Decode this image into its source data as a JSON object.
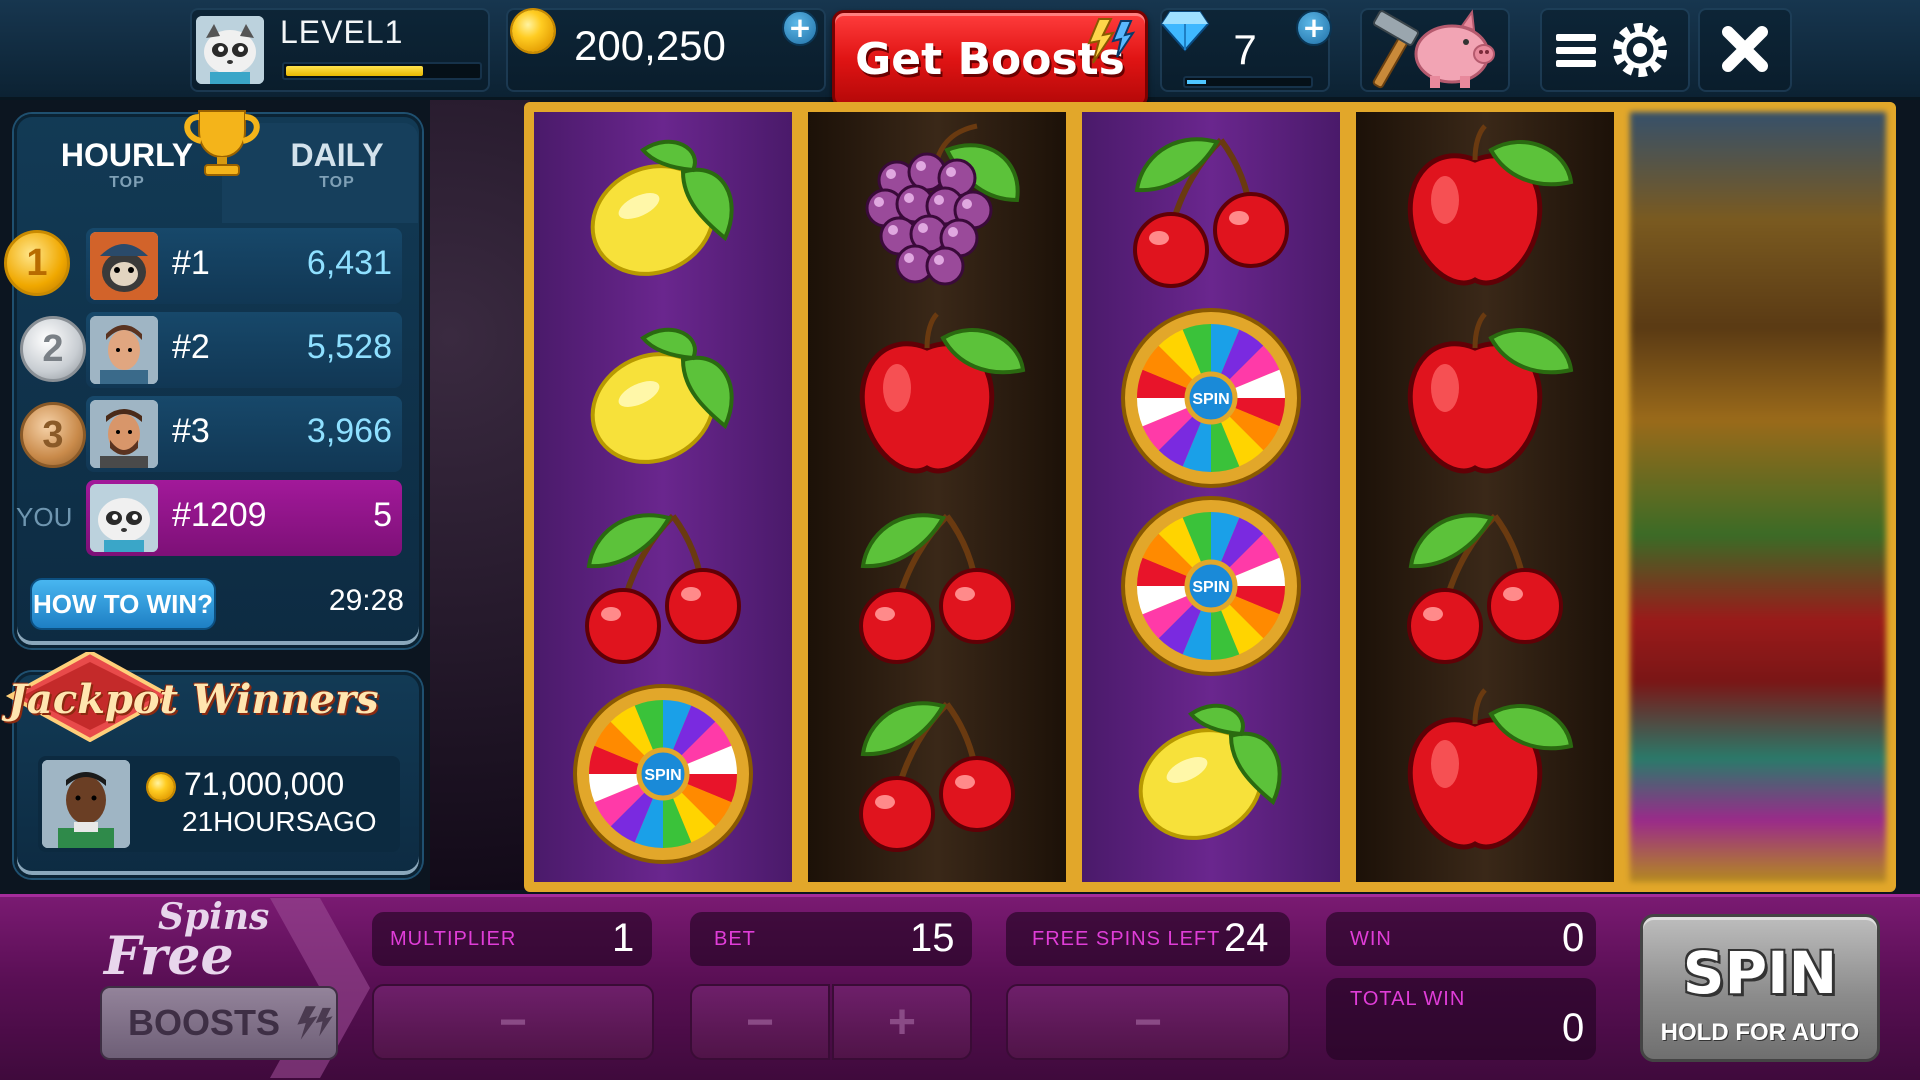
{
  "header": {
    "level_label": "LEVEL1",
    "level_progress": 0.7,
    "coins": "200,250",
    "get_boosts_label": "Get Boosts",
    "gems": "7",
    "gem_progress": 0.15
  },
  "leaderboard": {
    "tabs": [
      {
        "main": "HOURLY",
        "sub": "TOP"
      },
      {
        "main": "DAILY",
        "sub": "TOP"
      }
    ],
    "rows": [
      {
        "medal": "1",
        "rank": "#1",
        "score": "6,431"
      },
      {
        "medal": "2",
        "rank": "#2",
        "score": "5,528"
      },
      {
        "medal": "3",
        "rank": "#3",
        "score": "3,966"
      }
    ],
    "you_label": "YOU",
    "you_rank": "#1209",
    "you_score": "5",
    "how_to_win": "HOW TO WIN?",
    "timer": "29:28"
  },
  "jackpot": {
    "title": "Jackpot Winners",
    "amount": "71,000,000",
    "time_ago": "21HOURSAGO"
  },
  "reels": [
    [
      "lemon",
      "lemon",
      "cherry",
      "wheel"
    ],
    [
      "grapes",
      "apple",
      "cherry",
      "cherry"
    ],
    [
      "cherry",
      "wheel",
      "wheel",
      "lemon"
    ],
    [
      "apple",
      "apple",
      "cherry",
      "apple"
    ],
    [
      "spinning",
      "spinning",
      "spinning",
      "spinning"
    ]
  ],
  "wheel_label": "SPIN",
  "bottom": {
    "free_spins_top": "Spins",
    "free_spins_bottom": "Free",
    "boosts_label": "BOOSTS",
    "multiplier_label": "MULTIPLIER",
    "multiplier_value": "1",
    "bet_label": "BET",
    "bet_value": "15",
    "free_spins_left_label": "FREE SPINS LEFT",
    "free_spins_left_value": "24",
    "win_label": "WIN",
    "win_value": "0",
    "total_win_label": "TOTAL WIN",
    "total_win_value": "0",
    "minus": "−",
    "plus": "+",
    "spin_label": "SPIN",
    "spin_sub": "HOLD FOR AUTO"
  },
  "colors": {
    "accent_red": "#e01414",
    "coin_gold": "#ffcc22",
    "bottom_magenta": "#7a1a72",
    "reel_gold": "#e2a72a"
  }
}
